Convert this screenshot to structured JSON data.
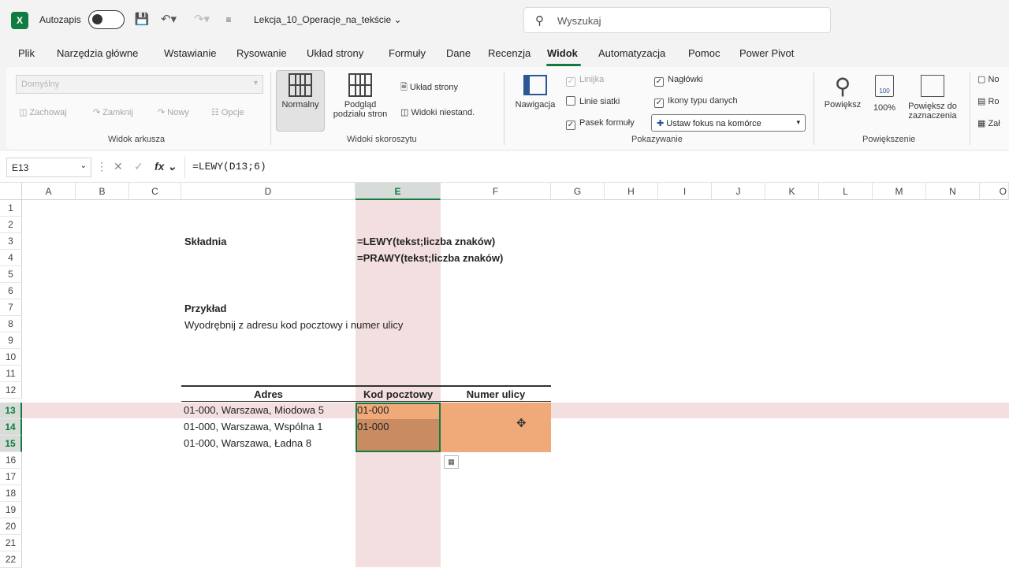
{
  "titlebar": {
    "app_logo": "X",
    "autosave_label": "Autozapis",
    "filename": "Lekcja_10_Operacje_na_tekście",
    "search_placeholder": "Wyszukaj"
  },
  "menu": [
    "Plik",
    "Narzędzia główne",
    "Wstawianie",
    "Rysowanie",
    "Układ strony",
    "Formuły",
    "Dane",
    "Recenzja",
    "Widok",
    "Automatyzacja",
    "Pomoc",
    "Power Pivot"
  ],
  "ribbon": {
    "sheet_view": {
      "dropdown": "Domyślny",
      "keep": "Zachowaj",
      "exit": "Zamknij",
      "new": "Nowy",
      "options": "Opcje",
      "label": "Widok arkusza"
    },
    "workbook_views": {
      "normal": "Normalny",
      "page_break_1": "Podgląd",
      "page_break_2": "podziału stron",
      "page_layout": "Układ strony",
      "custom": "Widoki niestand.",
      "label": "Widoki skoroszytu"
    },
    "show": {
      "navigation": "Nawigacja",
      "ruler": "Linijka",
      "gridlines": "Linie siatki",
      "formula_bar": "Pasek formuły",
      "headings": "Nagłówki",
      "data_type_icons": "Ikony typu danych",
      "focus_cell": "Ustaw fokus na komórce",
      "label": "Pokazywanie"
    },
    "zoom": {
      "zoom": "Powiększ",
      "hundred": "100%",
      "zoom_sel_1": "Powiększ do",
      "zoom_sel_2": "zaznaczenia",
      "label": "Powiększenie"
    },
    "window": {
      "a": "No",
      "b": "Ro",
      "c": "Zał"
    }
  },
  "formula_bar": {
    "name_box": "E13",
    "fx": "fx",
    "formula": "=LEWY(D13;6)"
  },
  "columns": [
    "A",
    "B",
    "C",
    "D",
    "E",
    "F",
    "G",
    "H",
    "I",
    "J",
    "K",
    "L",
    "M",
    "N",
    "O"
  ],
  "rows": [
    "1",
    "2",
    "3",
    "4",
    "5",
    "6",
    "7",
    "8",
    "9",
    "10",
    "11",
    "12",
    "13",
    "14",
    "15",
    "16",
    "17",
    "18",
    "19",
    "20",
    "21",
    "22"
  ],
  "cells": {
    "d3": "Składnia",
    "e3": "=LEWY(tekst;liczba znaków)",
    "e4": "=PRAWY(tekst;liczba znaków)",
    "d7": "Przykład",
    "d8": "Wyodrębnij z adresu kod pocztowy i numer ulicy"
  },
  "table": {
    "headers": [
      "Adres",
      "Kod pocztowy",
      "Numer ulicy"
    ],
    "rows": [
      [
        "01-000, Warszawa, Miodowa 5",
        "01-000",
        ""
      ],
      [
        "01-000, Warszawa, Wspólna 1",
        "01-000",
        ""
      ],
      [
        "01-000, Warszawa, Ładna 8",
        "",
        ""
      ]
    ]
  },
  "colors": {
    "accent": "#107c41",
    "band": "#f3dfdf",
    "fill": "#f0aa7a"
  }
}
